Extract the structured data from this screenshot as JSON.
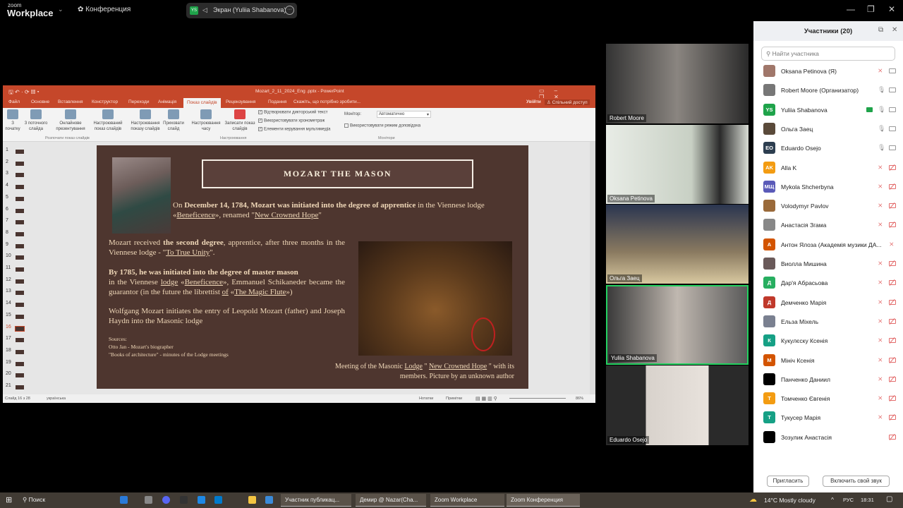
{
  "topbar": {
    "logo_small": "zoom",
    "logo_big": "Workplace",
    "meeting_label": "Конференция",
    "share_badge": "YS",
    "share_label": "Экран (Yuliia Shabanova)",
    "more": "···",
    "min": "—",
    "restore": "❐",
    "close": "✕"
  },
  "ppt": {
    "title": "Mozart_2_11_2024_Eng .pptx - PowerPoint",
    "tabs": [
      "Файл",
      "Основне",
      "Вставлення",
      "Конструктор",
      "Переходи",
      "Анімація",
      "Показ слайдів",
      "Рецензування",
      "Подання"
    ],
    "tell_me": "Скажіть, що потрібно зробити...",
    "signin": "Увійти",
    "share": "Спільний доступ",
    "ribbon": {
      "buttons": [
        "З початку",
        "З поточного слайда",
        "Онлайнове презентування",
        "Настроюваний показ слайдів",
        "Настроювання показу слайдів",
        "Приховати слайд",
        "Настроювання часу",
        "Записати показ слайдів"
      ],
      "groups": [
        "Розпочати показ слайдів",
        "Настроювання",
        "Монітори"
      ],
      "checks": [
        "Відтворювати дикторський текст",
        "Використовувати хронометраж",
        "Елементи керування мультимедіа"
      ],
      "monitor_label": "Монітор:",
      "monitor_value": "Автоматично",
      "presenter_view": "Використовувати режим доповідача"
    },
    "slide_numbers": [
      "1",
      "2",
      "3",
      "4",
      "5",
      "6",
      "7",
      "8",
      "9",
      "10",
      "11",
      "12",
      "13",
      "14",
      "15",
      "16",
      "17",
      "18",
      "19",
      "20",
      "21"
    ],
    "status": {
      "slide": "Слайд 16 з 28",
      "language": "українська",
      "notes": "Нотатки",
      "comments": "Примітки",
      "zoom": "86%"
    }
  },
  "slide": {
    "title": "MOZART THE MASON",
    "p1": {
      "a": "On ",
      "b": "December 14, 1784, Mozart was initiated into the degree of apprentice",
      "c": " in the Viennese lodge «",
      "d": "Beneficence",
      "e": "», renamed \"",
      "f": "New Crowned Hope",
      "g": "\""
    },
    "p2": {
      "a": "Mozart received ",
      "b": "the second degree",
      "c": ", apprentice, after three months in the Viennese lodge - \"",
      "d": "To True Unity",
      "e": "\"."
    },
    "p3": {
      "a": "By 1785, he was initiated into the degree of master mason",
      "b": "in the Viennese ",
      "c": "lodge",
      "d": " «",
      "e": "Beneficence",
      "f": "», Emmanuel Schikaneder became the guarantor (in the future the librettist ",
      "g": "of",
      "h": " «",
      "i": "The Magic Flute",
      "j": "»)"
    },
    "p4": "Wolfgang Mozart initiates the entry of Leopold Mozart (father) and Joseph Haydn into the Masonic lodge",
    "sources": [
      "Sources:",
      "Otto Jan - Mozart's biographer",
      "\"Books of architecture\" - minutes of the Lodge meetings"
    ],
    "caption": {
      "a": "Meeting of the Masonic ",
      "b": "Lodge",
      "c": " \" ",
      "d": "New Crowned Hope",
      "e": " \" with its members. Picture by an unknown author"
    }
  },
  "videos": [
    "Robert Moore",
    "Oksana Petinova",
    "Ольга Заец",
    "Yuliia Shabanova",
    "Eduardo Osejo"
  ],
  "panel": {
    "title": "Участники (20)",
    "search_placeholder": "Найти участника",
    "invite": "Пригласить",
    "unmute": "Включить свой звук",
    "participants": [
      {
        "name": "Oksana Petinova (Я)",
        "av": "",
        "color": "#a0776a",
        "mic": "off",
        "cam": "on"
      },
      {
        "name": "Robert Moore (Организатор)",
        "av": "",
        "color": "#777",
        "mic": "on",
        "cam": "on"
      },
      {
        "name": "Yuliia Shabanova",
        "av": "YS",
        "color": "#1fa34a",
        "mic": "on",
        "cam": "on",
        "sharing": true
      },
      {
        "name": "Ольга Заец",
        "av": "",
        "color": "#5a4a3a",
        "mic": "on",
        "cam": "on"
      },
      {
        "name": "Eduardo Osejo",
        "av": "EO",
        "color": "#2d3e50",
        "mic": "on",
        "cam": "on"
      },
      {
        "name": "Alla K",
        "av": "AK",
        "color": "#f39c12",
        "mic": "off",
        "cam": "off"
      },
      {
        "name": "Mykola Shcherbyna",
        "av": "МЩ",
        "color": "#5a5ab8",
        "mic": "off",
        "cam": "off"
      },
      {
        "name": "Volodymyr Pavlov",
        "av": "",
        "color": "#9a6a3a",
        "mic": "off",
        "cam": "off"
      },
      {
        "name": "Анастасія Згама",
        "av": "",
        "color": "#888",
        "mic": "off",
        "cam": "off"
      },
      {
        "name": "Антон Ялоза (Академія музики ДА...",
        "av": "А",
        "color": "#d35400",
        "mic": "off",
        "cam": "none"
      },
      {
        "name": "Виолла Мишина",
        "av": "",
        "color": "#6a5a5a",
        "mic": "off",
        "cam": "off"
      },
      {
        "name": "Дар'я Абрасьова",
        "av": "Д",
        "color": "#27ae60",
        "mic": "off",
        "cam": "off"
      },
      {
        "name": "Демченко Марія",
        "av": "Д",
        "color": "#c0392b",
        "mic": "off",
        "cam": "off"
      },
      {
        "name": "Ельза Міхель",
        "av": "",
        "color": "#7a8090",
        "mic": "off",
        "cam": "off"
      },
      {
        "name": "Кукулєску Ксенія",
        "av": "К",
        "color": "#16a085",
        "mic": "off",
        "cam": "off"
      },
      {
        "name": "Мініч Ксенія",
        "av": "М",
        "color": "#d35400",
        "mic": "off",
        "cam": "off"
      },
      {
        "name": "Панченко Даниил",
        "av": "",
        "color": "#000",
        "mic": "off",
        "cam": "off"
      },
      {
        "name": "Томченко Євгенія",
        "av": "Т",
        "color": "#f39c12",
        "mic": "off",
        "cam": "off"
      },
      {
        "name": "Тукусер Марія",
        "av": "Т",
        "color": "#16a085",
        "mic": "off",
        "cam": "off"
      },
      {
        "name": "Зозулик Анастасія",
        "av": "",
        "color": "#000",
        "mic": "none",
        "cam": "off"
      }
    ]
  },
  "taskbar": {
    "search": "Поиск",
    "apps": [
      "Участник публикац...",
      "Демир @ Nazar(Cha...",
      "Zoom Workplace",
      "Zoom Конференция"
    ],
    "weather": "14°C  Mostly cloudy",
    "lang": "РУС",
    "time": "18:31"
  }
}
